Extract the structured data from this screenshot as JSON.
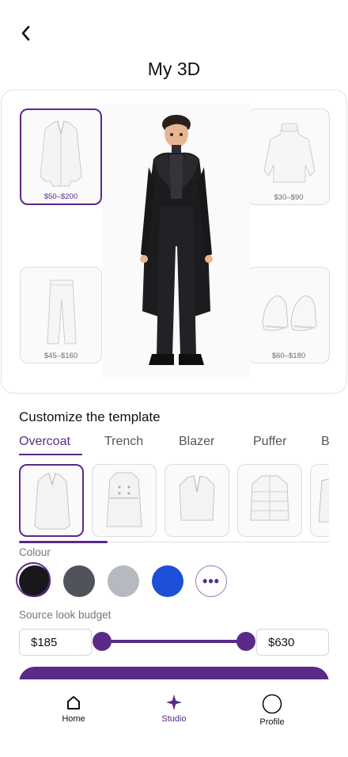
{
  "header": {
    "back_icon": "chevron-left-icon",
    "title": "My 3D"
  },
  "preview": {
    "slots": [
      {
        "id": "overcoat",
        "price": "$50–$200",
        "selected": true
      },
      {
        "id": "sweater",
        "price": "$30–$90",
        "selected": false
      },
      {
        "id": "trousers",
        "price": "$45–$160",
        "selected": false
      },
      {
        "id": "loafers",
        "price": "$60–$180",
        "selected": false
      }
    ]
  },
  "customize": {
    "title": "Customize the template",
    "tabs": [
      "Overcoat",
      "Trench",
      "Blazer",
      "Puffer",
      "B"
    ],
    "active_tab": "Overcoat",
    "variants": [
      "overcoat",
      "trench",
      "blazer",
      "puffer",
      "parka"
    ],
    "selected_variant": "overcoat"
  },
  "colour": {
    "label": "Colour",
    "swatches": [
      "#17171c",
      "#50535c",
      "#b6b9c0",
      "#1d4fd8"
    ],
    "selected": "#17171c",
    "more_icon": "more-icon",
    "more_label": "•••"
  },
  "budget": {
    "label": "Source look budget",
    "min": "$185",
    "max": "$630"
  },
  "accent_color": "#5b2a86",
  "nav": {
    "items": [
      {
        "label": "Home",
        "icon": "home-icon",
        "active": false
      },
      {
        "label": "Studio",
        "icon": "sparkle-icon",
        "active": true
      },
      {
        "label": "Profile",
        "icon": "profile-icon",
        "active": false
      }
    ]
  }
}
